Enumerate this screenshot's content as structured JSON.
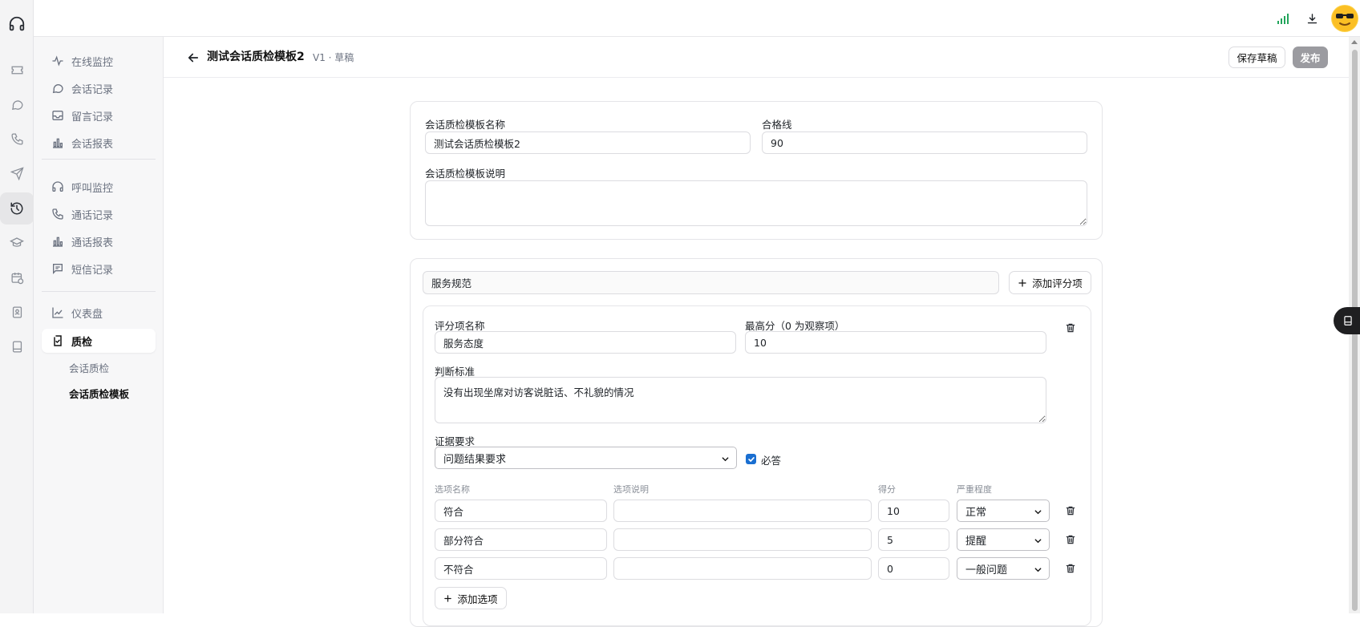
{
  "sidebar": {
    "items": [
      {
        "label": "在线监控",
        "icon": "activity-icon"
      },
      {
        "label": "会话记录",
        "icon": "chat-bubble-icon"
      },
      {
        "label": "留言记录",
        "icon": "inbox-icon"
      },
      {
        "label": "会话报表",
        "icon": "bar-chart-icon"
      },
      {
        "label": "呼叫监控",
        "icon": "headset-icon"
      },
      {
        "label": "通话记录",
        "icon": "phone-icon"
      },
      {
        "label": "通话报表",
        "icon": "bar-chart-icon"
      },
      {
        "label": "短信记录",
        "icon": "message-square-icon"
      },
      {
        "label": "仪表盘",
        "icon": "line-chart-icon"
      },
      {
        "label": "质检",
        "icon": "clipboard-check-icon"
      }
    ],
    "subitems": [
      {
        "label": "会话质检"
      },
      {
        "label": "会话质检模板"
      }
    ]
  },
  "header": {
    "title": "测试会话质检模板2",
    "version": "V1 · 草稿",
    "save_label": "保存草稿",
    "publish_label": "发布"
  },
  "template": {
    "name_label": "会话质检模板名称",
    "name_value": "测试会话质检模板2",
    "pass_label": "合格线",
    "pass_value": "90",
    "desc_label": "会话质检模板说明",
    "desc_value": ""
  },
  "category": {
    "name_value": "服务规范",
    "add_item_label": "添加评分项"
  },
  "item": {
    "name_label": "评分项名称",
    "name_value": "服务态度",
    "max_label": "最高分（0 为观察项）",
    "max_value": "10",
    "criteria_label": "判断标准",
    "criteria_value": "没有出现坐席对访客说脏话、不礼貌的情况",
    "evidence_label": "证据要求",
    "evidence_value": "问题结果要求",
    "required_label": "必答",
    "required_checked": true,
    "columns": {
      "name": "选项名称",
      "desc": "选项说明",
      "score": "得分",
      "severity": "严重程度"
    },
    "options": [
      {
        "name": "符合",
        "desc": "",
        "score": "10",
        "severity": "正常"
      },
      {
        "name": "部分符合",
        "desc": "",
        "score": "5",
        "severity": "提醒"
      },
      {
        "name": "不符合",
        "desc": "",
        "score": "0",
        "severity": "一般问题"
      }
    ],
    "add_option_label": "添加选项"
  },
  "colors": {
    "accent_checkbox": "#1a6fd1",
    "signal_green": "#22a55b",
    "publish_disabled": "#9b9ba0"
  }
}
